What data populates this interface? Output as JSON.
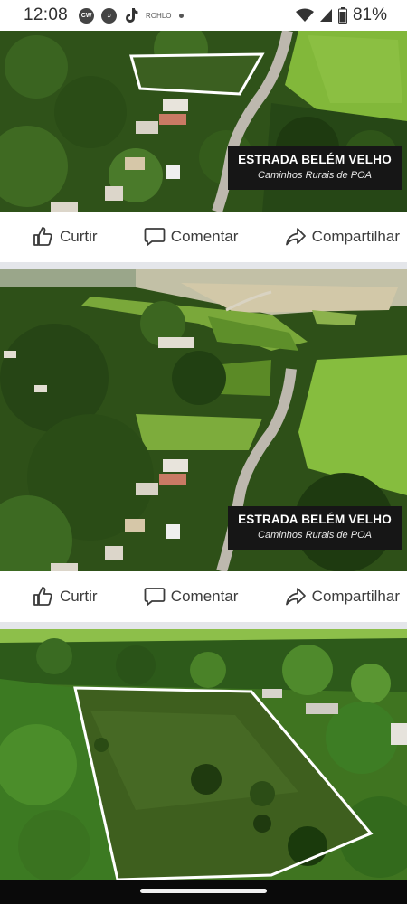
{
  "status_bar": {
    "time": "12:08",
    "notification_icons": [
      "cw-app-icon",
      "music-app-icon",
      "tiktok-icon"
    ],
    "notification_text": "ROHLO",
    "battery": "81%"
  },
  "posts": [
    {
      "caption_title": "ESTRADA BELÉM VELHO",
      "caption_subtitle": "Caminhos Rurais de POA"
    },
    {
      "caption_title": "ESTRADA BELÉM VELHO",
      "caption_subtitle": "Caminhos Rurais de POA"
    },
    {
      "caption_title": "",
      "caption_subtitle": ""
    }
  ],
  "actions": {
    "like": "Curtir",
    "comment": "Comentar",
    "share": "Compartilhar"
  },
  "colors": {
    "forest_dark": "#1f3a12",
    "forest_mid": "#3d6b1f",
    "pasture": "#7fb83a",
    "road": "#b9b6ae",
    "caption_bg": "#161616",
    "separator": "#e4e6ea"
  }
}
